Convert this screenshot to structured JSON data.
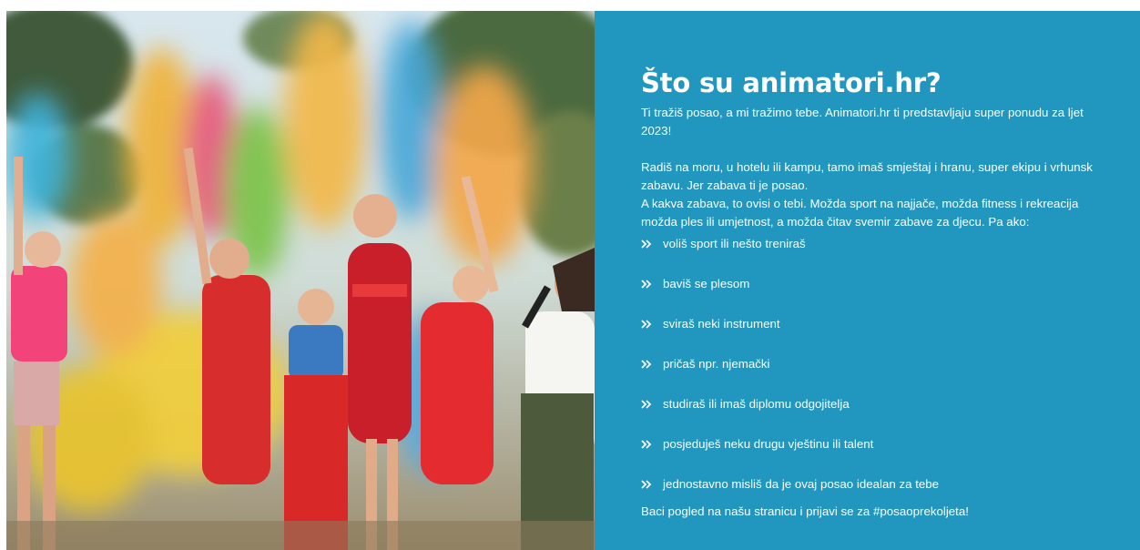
{
  "colors": {
    "panel_background": "#2196bf",
    "text": "#ffffff"
  },
  "photo": {
    "label": "photo-colored-powder-festival"
  },
  "content": {
    "title": "Što su animatori.hr?",
    "intro_line_1": "Ti tražiš posao, a mi tražimo tebe. Animatori.hr ti predstavljaju super ponudu za ljet",
    "intro_line_2": "2023!",
    "body_line_1": "Radiš na moru, u hotelu ili kampu, tamo imaš smještaj i hranu, super ekipu i vrhunsk",
    "body_line_2": "zabavu. Jer zabava ti je posao.",
    "body_line_3": "A kakva zabava, to ovisi o tebi. Možda sport na najjače, možda fitness i rekreacija",
    "body_line_4": "možda ples ili umjetnost, a možda čitav svemir zabave za djecu. Pa ako:",
    "bullet_icon": "double-chevron-right-icon",
    "bullets": [
      "voliš sport ili nešto treniraš",
      "baviš se plesom",
      "sviraš neki instrument",
      "pričaš npr. njemački",
      "studiraš ili imaš diplomu odgojitelja",
      "posjeduješ neku drugu vještinu ili talent",
      "jednostavno misliš da je ovaj posao idealan za tebe"
    ],
    "footer_line": "Baci pogled na našu stranicu i prijavi se za #posaoprekoljeta!"
  }
}
